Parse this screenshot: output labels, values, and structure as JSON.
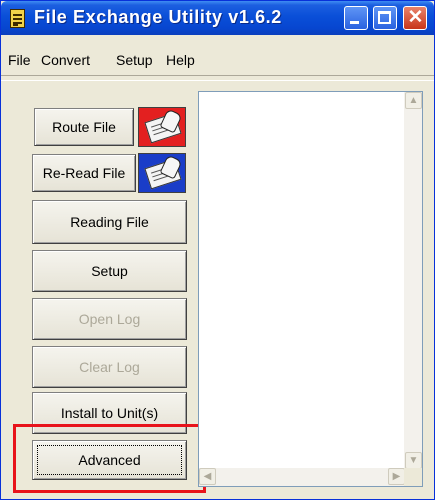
{
  "window": {
    "title": "File Exchange Utility v1.6.2"
  },
  "menu": {
    "items": [
      "File",
      "Convert",
      "Setup",
      "Help"
    ]
  },
  "buttons": {
    "route_file": "Route File",
    "reread_file": "Re-Read File",
    "reading_file": "Reading File",
    "setup": "Setup",
    "open_log": "Open Log",
    "clear_log": "Clear Log",
    "install_to_units": "Install to Unit(s)",
    "advanced": "Advanced"
  },
  "button_states": {
    "open_log": "disabled",
    "clear_log": "disabled",
    "advanced": "focused"
  },
  "icons": {
    "app": "app-notepad-icon",
    "route": "writing-hand-red-icon",
    "reread": "writing-hand-blue-icon"
  },
  "colors": {
    "titlebar": "#0a4fd8",
    "highlight": "#e8131b",
    "route_icon_bg": "#e32020",
    "reread_icon_bg": "#1a3dc8",
    "disabled_text": "#aca899"
  }
}
